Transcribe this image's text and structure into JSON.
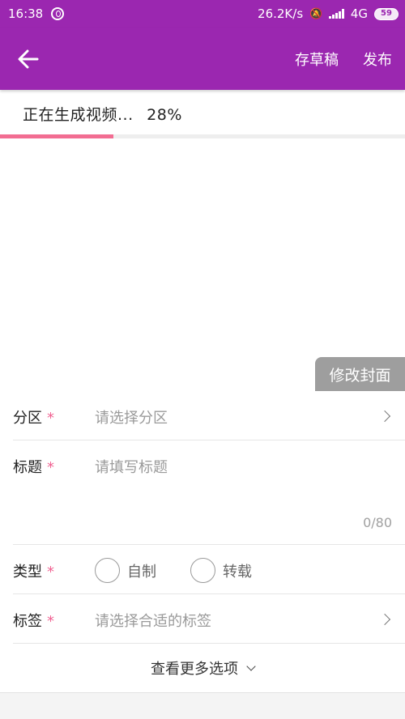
{
  "status_bar": {
    "time": "16:38",
    "net_speed": "26.2K/s",
    "network": "4G",
    "battery": "59",
    "bg_color": "#9b27b0"
  },
  "toolbar": {
    "back_icon": "arrow-left-icon",
    "save_draft_label": "存草稿",
    "publish_label": "发布"
  },
  "progress": {
    "text": "正在生成视频...",
    "percent_text": "28%",
    "value": 0.28,
    "color": "#f26d92"
  },
  "cover": {
    "edit_label": "修改封面"
  },
  "form": {
    "zone": {
      "label": "分区",
      "placeholder": "请选择分区"
    },
    "title": {
      "label": "标题",
      "placeholder": "请填写标题",
      "counter": "0/80"
    },
    "type": {
      "label": "类型",
      "options": [
        "自制",
        "转载"
      ]
    },
    "tags": {
      "label": "标签",
      "placeholder": "请选择合适的标签"
    },
    "required_mark": "*"
  },
  "more_options": {
    "label": "查看更多选项"
  }
}
